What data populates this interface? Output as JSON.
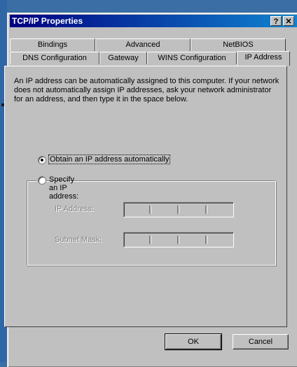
{
  "window": {
    "title": "TCP/IP Properties",
    "help_symbol": "?",
    "close_symbol": "✕"
  },
  "tabs_back": [
    "Bindings",
    "Advanced",
    "NetBIOS"
  ],
  "tabs_front": [
    "DNS Configuration",
    "Gateway",
    "WINS Configuration",
    "IP Address"
  ],
  "active_tab": "IP Address",
  "description": "An IP address can be automatically assigned to this computer. If your network does not automatically assign IP addresses, ask your network administrator for an address, and then type it in the space below.",
  "options": {
    "obtain": {
      "label": "Obtain an IP address automatically",
      "selected": true
    },
    "specify": {
      "label": "Specify an IP address:",
      "selected": false
    }
  },
  "fields": {
    "ip_address_label": "IP Address:",
    "subnet_mask_label": "Subnet Mask:",
    "ip_separators": ".",
    "enabled": false
  },
  "buttons": {
    "ok": "OK",
    "cancel": "Cancel"
  }
}
